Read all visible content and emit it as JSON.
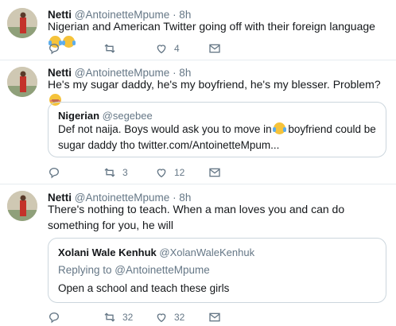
{
  "tweets": [
    {
      "name": "Netti",
      "handle": "@AntoinetteMpume",
      "time": "· 8h",
      "text": "Nigerian and American Twitter going off with their foreign language",
      "emojis": [
        "face-with-tears-of-joy",
        "loudly-crying-face"
      ],
      "reply_count": "",
      "retweet_count": "",
      "like_count": "4"
    },
    {
      "name": "Netti",
      "handle": "@AntoinetteMpume",
      "time": "· 8h",
      "text": "He's my sugar daddy, he's my boyfriend, he's my blesser. Problem?",
      "emojis": [
        "smiling-face-with-smiling-eyes"
      ],
      "quote": {
        "name": "Nigerian",
        "handle": "@segebee",
        "text_before_emoji": "Def not naija. Boys would ask you to move in",
        "text_after_emoji": " boyfriend could be sugar daddy tho twitter.com/AntoinetteMpum..."
      },
      "reply_count": "",
      "retweet_count": "3",
      "like_count": "12"
    },
    {
      "name": "Netti",
      "handle": "@AntoinetteMpume",
      "time": "· 8h",
      "text": "There's nothing to teach. When a man loves you and can do something for you, he will",
      "quote": {
        "name": "Xolani Wale Kenhuk",
        "handle": "@XolanWaleKenhuk",
        "replying_to": "Replying to @AntoinetteMpume",
        "text": "Open a school and teach these girls"
      },
      "reply_count": "",
      "retweet_count": "32",
      "like_count": "32"
    }
  ],
  "colors": {
    "text": "#14171a",
    "secondary": "#657786",
    "border": "#e6ecf0"
  },
  "icons": [
    "reply-icon",
    "retweet-icon",
    "like-icon",
    "message-icon"
  ]
}
